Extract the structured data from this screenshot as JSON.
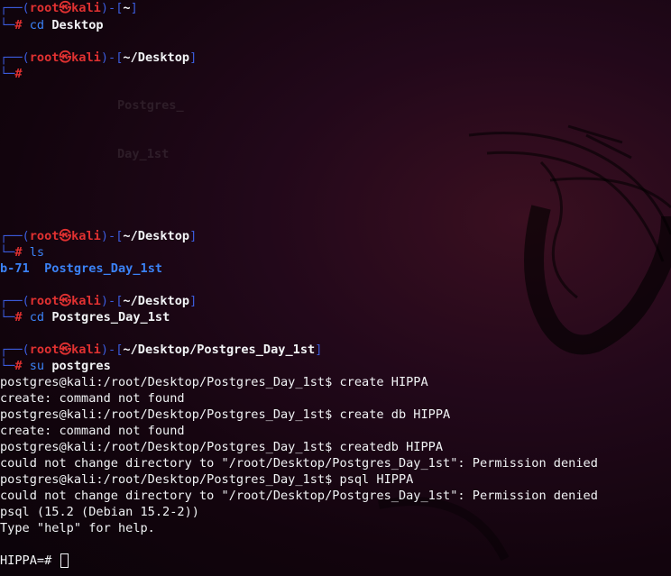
{
  "colors": {
    "box": "#3b5bdb",
    "user_host": "#e03131",
    "path": "#f1f3f5",
    "command": "#3b82f6",
    "background": "#1a0612"
  },
  "prompts": [
    {
      "user": "root",
      "sep_icon": "kali-skull-icon",
      "host": "kali",
      "cwd": "~",
      "command": "cd",
      "args": "Desktop"
    },
    {
      "user": "root",
      "sep_icon": "kali-skull-icon",
      "host": "kali",
      "cwd": "~/Desktop",
      "command": "",
      "args": ""
    },
    {
      "user": "root",
      "sep_icon": "kali-skull-icon",
      "host": "kali",
      "cwd": "~/Desktop",
      "command": "ls",
      "args": ""
    },
    {
      "user": "root",
      "sep_icon": "kali-skull-icon",
      "host": "kali",
      "cwd": "~/Desktop",
      "command": "cd",
      "args": "Postgres_Day_1st"
    },
    {
      "user": "root",
      "sep_icon": "kali-skull-icon",
      "host": "kali",
      "cwd": "~/Desktop/Postgres_Day_1st",
      "command": "su",
      "args": "postgres"
    }
  ],
  "ghost_text": [
    "Postgres_",
    "Day_1st"
  ],
  "ls_output": {
    "item1": "b-71",
    "item2": "Postgres_Day_1st"
  },
  "postgres_session": [
    "postgres@kali:/root/Desktop/Postgres_Day_1st$ create HIPPA",
    "create: command not found",
    "postgres@kali:/root/Desktop/Postgres_Day_1st$ create db HIPPA",
    "create: command not found",
    "postgres@kali:/root/Desktop/Postgres_Day_1st$ createdb HIPPA",
    "could not change directory to \"/root/Desktop/Postgres_Day_1st\": Permission denied",
    "postgres@kali:/root/Desktop/Postgres_Day_1st$ psql HIPPA",
    "could not change directory to \"/root/Desktop/Postgres_Day_1st\": Permission denied",
    "psql (15.2 (Debian 15.2-2))",
    "Type \"help\" for help."
  ],
  "psql_prompt": "HIPPA=#"
}
